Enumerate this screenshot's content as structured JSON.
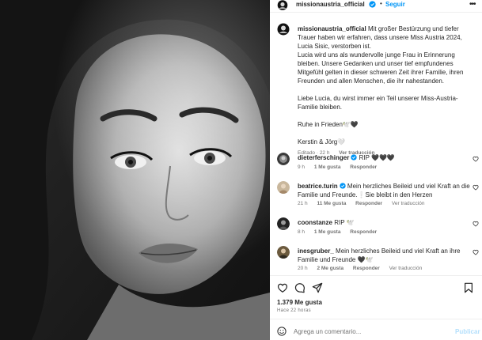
{
  "post": {
    "username": "missionaustria_official",
    "follow_label": "Seguir",
    "separator": "•",
    "more": "•••"
  },
  "caption": {
    "username": "missionaustria_official",
    "line1": "Mit großer Bestürzung und tiefer Trauer haben wir erfahren, dass unsere Miss Austria 2024, Lucia Sisic, verstorben ist.",
    "line2": "Lucia wird uns als wundervolle junge Frau in Erinnerung bleiben. Unsere Gedanken und unser tief empfundenes Mitgefühl gelten in dieser schweren Zeit ihrer Familie, ihren Freunden und allen Menschen, die ihr nahestanden.",
    "line3": "Liebe Lucia, du wirst immer ein Teil unserer Miss-Austria-Familie bleiben.",
    "line4": "Ruhe in Frieden🕊️🖤",
    "line5": "Kerstin & Jörg🤍",
    "edited": "Editado · 22 h",
    "translate": "Ver traducción"
  },
  "comments": [
    {
      "user": "dieterferschinger",
      "verified": true,
      "text": "RIP 🖤🖤🖤",
      "time": "9 h",
      "likes": "1 Me gusta",
      "reply": "Responder",
      "translate": ""
    },
    {
      "user": "beatrice.turin",
      "verified": true,
      "text": "Mein herzliches Beileid und viel Kraft an die Familie und Freunde.❕Sie bleibt in den Herzen",
      "time": "21 h",
      "likes": "11 Me gusta",
      "reply": "Responder",
      "translate": "Ver traducción"
    },
    {
      "user": "coonstanze",
      "verified": false,
      "text": "RIP 🕊️",
      "time": "8 h",
      "likes": "1 Me gusta",
      "reply": "Responder",
      "translate": ""
    },
    {
      "user": "inesgruber_",
      "verified": false,
      "text": "Mein herzliches Beileid und viel Kraft an ihre Familie und Freunde 🖤🕊️",
      "time": "20 h",
      "likes": "2 Me gusta",
      "reply": "Responder",
      "translate": "Ver traducción"
    }
  ],
  "likes_count": "1.379 Me gusta",
  "time_ago": "Hace 22 horas",
  "add_comment": {
    "placeholder": "Agrega un comentario...",
    "publish": "Publicar"
  },
  "colors": {
    "accent": "#0095f6",
    "verified": "#0095f6",
    "muted": "#737373",
    "publish_disabled": "#b2dffc"
  }
}
